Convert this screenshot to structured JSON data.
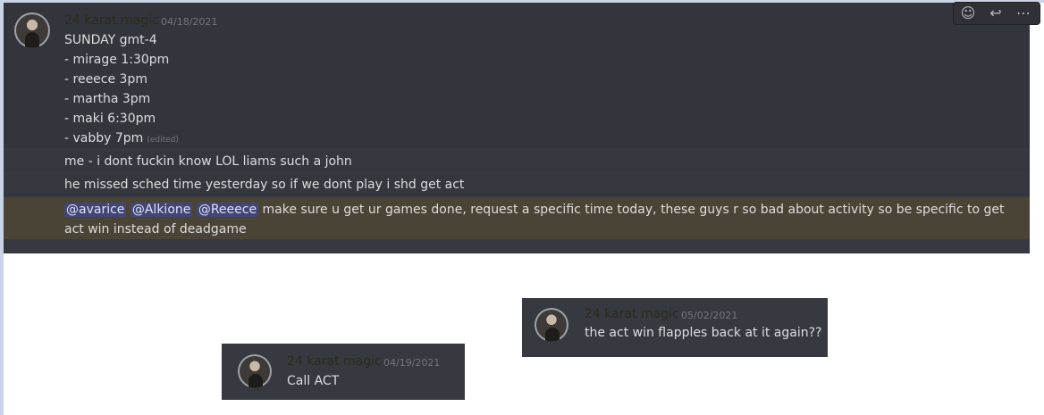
{
  "message_1": {
    "author": "24 karat magic",
    "timestamp": "04/18/2021",
    "lines": [
      "SUNDAY gmt-4",
      "- mirage 1:30pm",
      "- reeece 3pm",
      "- martha 3pm",
      "- maki 6:30pm",
      "- vabby 7pm"
    ],
    "edited_tag": "(edited)",
    "followups": [
      "me - i dont fuckin know LOL liams such a john",
      "he missed sched time yesterday so if we dont play i shd get act"
    ],
    "highlighted": {
      "mentions": [
        "@avarice",
        "@Alkione",
        "@Reeece"
      ],
      "text": "make sure u get ur games done, request a specific time today, these guys r so bad about activity so be specific to get act win instead of deadgame"
    }
  },
  "toolbar": {
    "icons": [
      "add-reaction-icon",
      "reply-icon",
      "more-icon"
    ],
    "glyphs": [
      "☺",
      "↩",
      "⋯"
    ]
  },
  "card_1": {
    "author": "24 karat magic",
    "timestamp": "05/02/2021",
    "text": "the act win flapples back at it again??"
  },
  "card_2": {
    "author": "24 karat magic",
    "timestamp": "04/19/2021",
    "text": "Call ACT"
  },
  "colors": {
    "background": "#36393f",
    "mention": "#414675",
    "highlight": "#4a4437"
  }
}
